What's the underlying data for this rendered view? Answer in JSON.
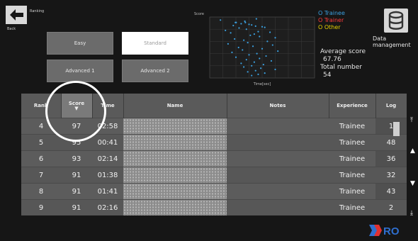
{
  "header": {
    "title": "Ranking",
    "back_label": "Back"
  },
  "levels": [
    {
      "label": "Easy",
      "active": false
    },
    {
      "label": "Standard",
      "active": true
    },
    {
      "label": "Advanced 1",
      "active": false
    },
    {
      "label": "Advanced 2",
      "active": false
    }
  ],
  "legend": {
    "trainee": "O Trainee",
    "trainer": "O Trainer",
    "other": "O Other"
  },
  "stats": {
    "average_label": "Average score",
    "average_value": "67.76",
    "total_label": "Total number",
    "total_value": "54"
  },
  "data_management": {
    "label_line1": "Data",
    "label_line2": "management",
    "icon": "database-icon"
  },
  "table": {
    "headers": [
      "Rank",
      "Score",
      "Time",
      "Name",
      "Notes",
      "Experience",
      "Log"
    ],
    "rows": [
      {
        "rank": "4",
        "score": "97",
        "time": "02:58",
        "name": "",
        "notes": "",
        "experience": "Trainee",
        "log": "1"
      },
      {
        "rank": "5",
        "score": "95",
        "time": "00:41",
        "name": "",
        "notes": "",
        "experience": "Trainee",
        "log": "48"
      },
      {
        "rank": "6",
        "score": "93",
        "time": "02:14",
        "name": "",
        "notes": "",
        "experience": "Trainee",
        "log": "36"
      },
      {
        "rank": "7",
        "score": "91",
        "time": "01:38",
        "name": "",
        "notes": "",
        "experience": "Trainee",
        "log": "32"
      },
      {
        "rank": "8",
        "score": "91",
        "time": "01:41",
        "name": "",
        "notes": "",
        "experience": "Trainee",
        "log": "43"
      },
      {
        "rank": "9",
        "score": "91",
        "time": "02:16",
        "name": "",
        "notes": "",
        "experience": "Trainee",
        "log": "2"
      }
    ]
  },
  "logo": {
    "text": "RO"
  },
  "colors": {
    "trainee": "#3aa0e0",
    "trainer": "#ff3a3a",
    "other": "#e6d100",
    "panel": "#5c5c5c",
    "active_button": "#ffffff"
  },
  "chart_data": {
    "type": "scatter",
    "ylabel": "Score",
    "xlabel": "Time[sec]",
    "ylim": [
      0,
      100
    ],
    "xlim": [
      0,
      400
    ],
    "grid": true,
    "series": [
      {
        "name": "Trainee",
        "color": "#3aa0e0",
        "points": [
          [
            178,
            97
          ],
          [
            41,
            95
          ],
          [
            134,
            93
          ],
          [
            98,
            91
          ],
          [
            101,
            91
          ],
          [
            136,
            91
          ],
          [
            120,
            89
          ],
          [
            150,
            88
          ],
          [
            160,
            87
          ],
          [
            90,
            86
          ],
          [
            175,
            85
          ],
          [
            200,
            84
          ],
          [
            210,
            83
          ],
          [
            112,
            82
          ],
          [
            140,
            80
          ],
          [
            60,
            78
          ],
          [
            185,
            76
          ],
          [
            230,
            75
          ],
          [
            80,
            74
          ],
          [
            170,
            72
          ],
          [
            155,
            70
          ],
          [
            190,
            68
          ],
          [
            250,
            66
          ],
          [
            95,
            64
          ],
          [
            130,
            62
          ],
          [
            220,
            60
          ],
          [
            145,
            58
          ],
          [
            70,
            56
          ],
          [
            240,
            54
          ],
          [
            165,
            52
          ],
          [
            110,
            50
          ],
          [
            200,
            48
          ],
          [
            125,
            46
          ],
          [
            260,
            44
          ],
          [
            85,
            42
          ],
          [
            180,
            40
          ],
          [
            150,
            38
          ],
          [
            215,
            36
          ],
          [
            100,
            34
          ],
          [
            190,
            32
          ],
          [
            140,
            30
          ],
          [
            235,
            28
          ],
          [
            170,
            26
          ],
          [
            120,
            24
          ],
          [
            205,
            22
          ],
          [
            160,
            20
          ],
          [
            130,
            18
          ],
          [
            195,
            16
          ],
          [
            250,
            14
          ],
          [
            175,
            12
          ],
          [
            145,
            10
          ],
          [
            210,
            8
          ],
          [
            185,
            6
          ],
          [
            160,
            4
          ]
        ]
      }
    ]
  }
}
